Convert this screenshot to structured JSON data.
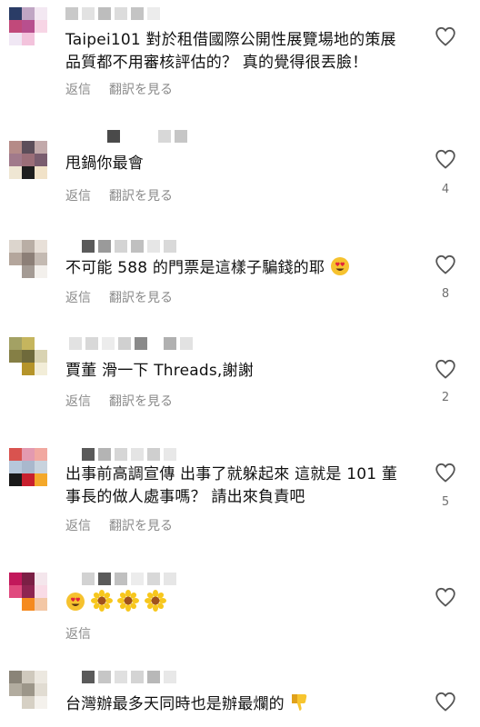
{
  "comments": [
    {
      "text": "Taipei101 對於租借國際公開性展覽場地的策展品質都不用審核評估的？ 真的覺得很丟臉！",
      "reply": "返信",
      "translate": "翻訳を見る",
      "like_count": ""
    },
    {
      "text": "甩鍋你最會",
      "reply": "返信",
      "translate": "翻訳を見る",
      "like_count": "4"
    },
    {
      "text": "不可能 588 的門票是這樣子騙錢的耶",
      "emoji": "heart-eyes-emoji",
      "reply": "返信",
      "translate": "翻訳を見る",
      "like_count": "8"
    },
    {
      "text": "賈董 滑一下 Threads,謝謝",
      "reply": "返信",
      "translate": "翻訳を見る",
      "like_count": "2"
    },
    {
      "text": "出事前高調宣傳 出事了就躲起來 這就是 101 董事長的做人處事嗎？ 請出來負責吧",
      "reply": "返信",
      "translate": "翻訳を見る",
      "like_count": "5"
    },
    {
      "text": "",
      "emoji_sequence": [
        "heart-eyes-emoji",
        "sunflower-emoji",
        "sunflower-emoji",
        "sunflower-emoji"
      ],
      "reply": "返信",
      "like_count": ""
    },
    {
      "text": "台灣辦最多天同時也是辦最爛的",
      "emoji": "thumbs-down-emoji",
      "like_count": ""
    }
  ],
  "colors": {
    "text": "#111111",
    "secondary": "#8a8a8a",
    "icon": "#555555"
  }
}
